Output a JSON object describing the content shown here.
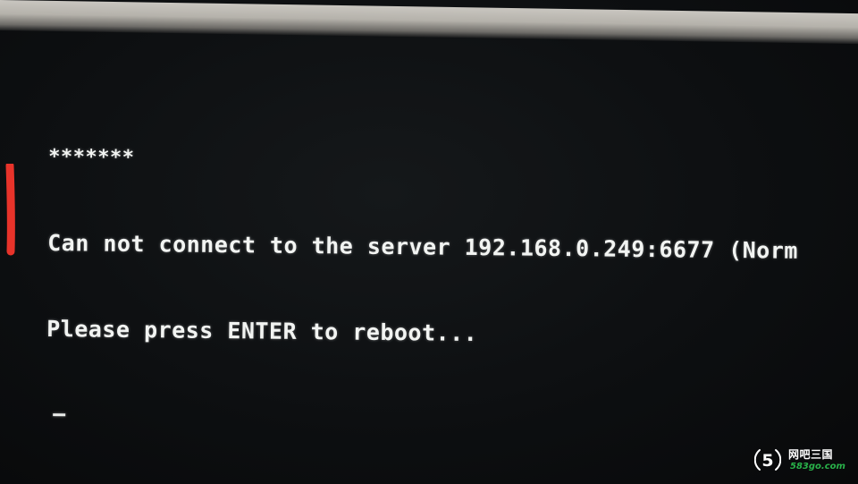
{
  "screen": {
    "stars": "*******",
    "line1": "Can not connect to the server 192.168.0.249:6677 (Norm",
    "line2": "Please press ENTER to reboot...",
    "cursor": "_"
  },
  "annotation": {
    "color": "#e8332a"
  },
  "watermark": {
    "name": "网吧三国",
    "site": "583go.com",
    "badge": "5",
    "site_color": "#29b24a"
  }
}
